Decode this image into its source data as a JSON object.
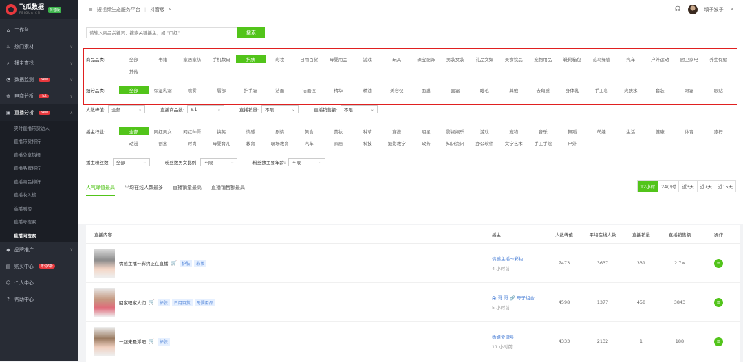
{
  "logo": {
    "name": "飞瓜数据",
    "sub": "FEIGUA.CN",
    "badge": "抖音版"
  },
  "sidebar": {
    "items": [
      {
        "label": "工作台",
        "icon": "home-icon"
      },
      {
        "label": "热门素材",
        "icon": "fire-icon"
      },
      {
        "label": "播主查找",
        "icon": "search-icon"
      },
      {
        "label": "数据监测",
        "icon": "monitor-icon",
        "badge": "New"
      },
      {
        "label": "电商分析",
        "icon": "cart-icon",
        "badge": "Hot"
      },
      {
        "label": "直播分析",
        "icon": "live-icon",
        "badge": "New"
      }
    ],
    "sub": [
      "实时直播带货达人",
      "直播带货排行",
      "直播分享热榜",
      "直播品牌排行",
      "直播商品排行",
      "直播收入榜",
      "连播刷榜",
      "直播号搜索",
      "直播间搜索"
    ],
    "bottom": [
      {
        "label": "品牌推广",
        "icon": "diamond-icon"
      },
      {
        "label": "购买中心",
        "icon": "wallet-icon",
        "badge": "年付6折"
      },
      {
        "label": "个人中心",
        "icon": "user-icon"
      },
      {
        "label": "帮助中心",
        "icon": "help-icon"
      }
    ]
  },
  "topbar": {
    "menu": "短视频生态服务平台",
    "version": "抖音版",
    "user": "填子波子"
  },
  "search": {
    "placeholder": "请输入商品关键词、搜索关键播主，如 \"口红\"",
    "button": "搜索"
  },
  "category": {
    "label": "商品品类:",
    "options": [
      "全部",
      "书籍",
      "家居家纺",
      "手机数码",
      "护肤",
      "彩妆",
      "日用百货",
      "母婴用品",
      "游戏",
      "玩具",
      "珠宝配饰",
      "男装女装",
      "礼品文娱",
      "美食饮品",
      "宠物用品",
      "鞋靴箱包",
      "花鸟绿植",
      "汽车",
      "户外运动",
      "厨卫家电",
      "养生保健",
      "其他"
    ]
  },
  "subcategory": {
    "label": "细分品类:",
    "options": [
      "全部",
      "保湿乳霜",
      "喷雾",
      "唇部",
      "护手霜",
      "洁面",
      "洁面仪",
      "精华",
      "精油",
      "美容仪",
      "面膜",
      "面霜",
      "睫毛",
      "其他",
      "去角质",
      "身体乳",
      "手工皂",
      "爽肤水",
      "套装",
      "眼霜",
      "眼贴"
    ]
  },
  "filters1": [
    {
      "label": "人数峰值:",
      "value": "全部"
    },
    {
      "label": "直播商品数:",
      "value": "≥1"
    },
    {
      "label": "直播销量:",
      "value": "不限"
    },
    {
      "label": "直播销售额:",
      "value": "不限"
    }
  ],
  "industry": {
    "label": "播主行业:",
    "row1": [
      "全部",
      "网红美女",
      "网红帅哥",
      "搞笑",
      "情感",
      "剧情",
      "美食",
      "美妆",
      "种草",
      "穿搭",
      "明星",
      "影视娱乐",
      "游戏",
      "宠物",
      "音乐",
      "舞蹈",
      "萌娃",
      "生活",
      "健康",
      "体育",
      "旅行"
    ],
    "row2": [
      "动漫",
      "创意",
      "时尚",
      "母婴育儿",
      "教育",
      "职场教育",
      "汽车",
      "家居",
      "科技",
      "摄影教学",
      "政务",
      "知识资讯",
      "办公软件",
      "文学艺术",
      "手工手绘",
      "户外"
    ]
  },
  "filters2": [
    {
      "label": "播主粉丝数:",
      "value": "全部"
    },
    {
      "label": "粉丝数男女比例:",
      "value": "不限"
    },
    {
      "label": "粉丝数主要年龄:",
      "value": "不限"
    }
  ],
  "tabs": [
    "人气峰值最高",
    "平均在线人数最多",
    "直播销量最高",
    "直播销售额最高"
  ],
  "times": [
    "12小时",
    "24小时",
    "近3天",
    "近7天",
    "近15天"
  ],
  "table": {
    "headers": [
      "直播内容",
      "播主",
      "人数峰值",
      "平均在线人数",
      "直播销量",
      "直播销售额",
      "操作"
    ],
    "rows": [
      {
        "title": "情感主播～彩约正在直播",
        "tags": [
          "护肤",
          "彩妆"
        ],
        "anchor": "情感主播～彩约",
        "time": "4 小时前",
        "peak": "7473",
        "avg": "3637",
        "sales": "331",
        "revenue": "2.7w"
      },
      {
        "title": "回家吧家人们",
        "tags": [
          "护肤",
          "日用百货",
          "母婴用品"
        ],
        "anchor": "朵 哥 哥 🔗 母子组合",
        "time": "5 小时前",
        "peak": "4598",
        "avg": "1377",
        "sales": "458",
        "revenue": "3843"
      },
      {
        "title": "一起来悬浮吧",
        "tags": [
          "护肤"
        ],
        "anchor": "悉姐爱健身",
        "time": "11 小时前",
        "peak": "4333",
        "avg": "2132",
        "sales": "1",
        "revenue": "188"
      }
    ]
  }
}
